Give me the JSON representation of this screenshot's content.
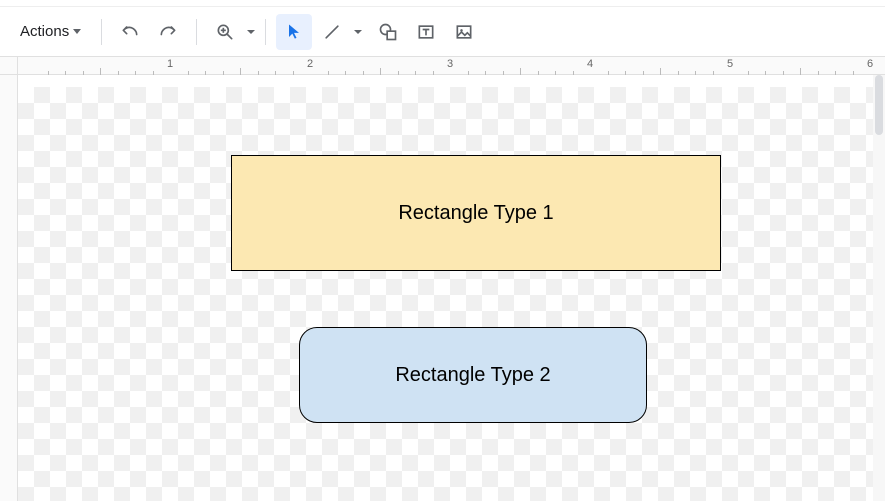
{
  "toolbar": {
    "actions_label": "Actions"
  },
  "ruler": {
    "labels": [
      "1",
      "2",
      "3",
      "4",
      "5",
      "6"
    ]
  },
  "shapes": {
    "rect1": {
      "label": "Rectangle Type 1"
    },
    "rect2": {
      "label": "Rectangle Type 2"
    }
  },
  "colors": {
    "rect1_fill": "#fce8b2",
    "rect2_fill": "#cfe2f3",
    "active_tool": "#e8f0fe"
  }
}
